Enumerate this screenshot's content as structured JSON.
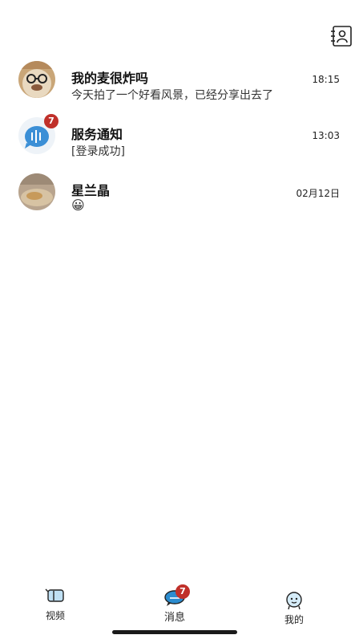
{
  "conversations": [
    {
      "name": "我的麦很炸吗",
      "preview": "今天拍了一个好看风景，已经分享出去了",
      "time": "18:15",
      "badge": ""
    },
    {
      "name": "服务通知",
      "preview": "[登录成功]",
      "time": "13:03",
      "badge": "7"
    },
    {
      "name": "星兰晶",
      "preview": "😀",
      "time": "02月12日",
      "badge": ""
    }
  ],
  "tabs": [
    {
      "label": "视频",
      "icon": "video-icon"
    },
    {
      "label": "消息",
      "icon": "message-icon",
      "badge": "7"
    },
    {
      "label": "我的",
      "icon": "profile-icon"
    }
  ],
  "colors": {
    "badge": "#c0302a",
    "accent": "#3b8fd6"
  }
}
